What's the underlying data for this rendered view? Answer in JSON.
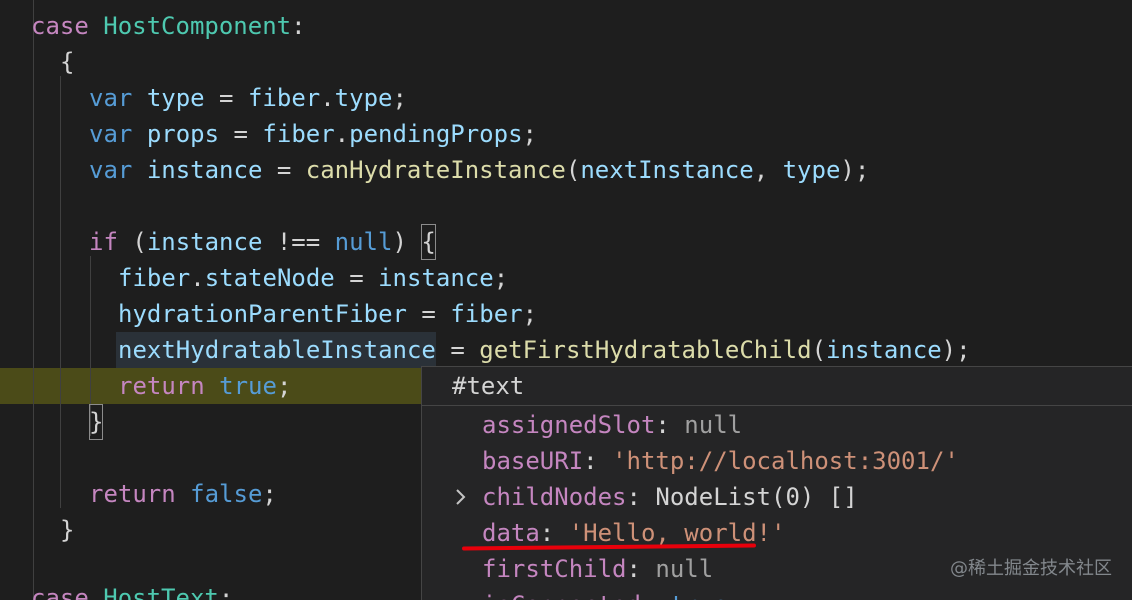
{
  "code": {
    "line_top_fragment": "",
    "case1_kw": "case",
    "case1_name": "HostComponent",
    "case1_colon": ":",
    "open_brace": "{",
    "l_var1_kw": "var",
    "l_var1_name": "type",
    "l_var1_eq": " = ",
    "l_var1_obj": "fiber",
    "l_var1_dot": ".",
    "l_var1_prop": "type",
    "l_var1_end": ";",
    "l_var2_kw": "var",
    "l_var2_name": "props",
    "l_var2_eq": " = ",
    "l_var2_obj": "fiber",
    "l_var2_dot": ".",
    "l_var2_prop": "pendingProps",
    "l_var2_end": ";",
    "l_var3_kw": "var",
    "l_var3_name": "instance",
    "l_var3_eq": " = ",
    "l_var3_fn": "canHydrateInstance",
    "l_var3_open": "(",
    "l_var3_arg1": "nextInstance",
    "l_var3_comma": ", ",
    "l_var3_arg2": "type",
    "l_var3_end": ");",
    "if_kw": "if",
    "if_open": " (",
    "if_var": "instance",
    "if_op": " !== ",
    "if_null": "null",
    "if_close": ") ",
    "if_brace": "{",
    "s1_obj": "fiber",
    "s1_dot": ".",
    "s1_prop": "stateNode",
    "s1_eq": " = ",
    "s1_val": "instance",
    "s1_end": ";",
    "s2_var": "hydrationParentFiber",
    "s2_eq": " = ",
    "s2_val": "fiber",
    "s2_end": ";",
    "s3_var": "nextHydratableInstance",
    "s3_eq": " = ",
    "s3_fn": "getFirstHydratableChild",
    "s3_open": "(",
    "s3_arg": "instance",
    "s3_end": ");",
    "ret_true_kw": "return",
    "ret_true_val": "true",
    "ret_true_end": ";",
    "inner_close": "}",
    "ret_false_kw": "return",
    "ret_false_val": "false",
    "ret_false_end": ";",
    "outer_close": "}",
    "case2_kw": "case",
    "case2_name": "HostText",
    "case2_colon": ":"
  },
  "hover": {
    "title": "#text",
    "props": [
      {
        "name": "assignedSlot",
        "sep": ": ",
        "value": "null"
      },
      {
        "name": "baseURI",
        "sep": ": ",
        "value": "'http://localhost:3001/'"
      },
      {
        "name": "childNodes",
        "sep": ": ",
        "value": "NodeList(0) []"
      },
      {
        "name": "data",
        "sep": ": ",
        "value": "'Hello, world!'"
      },
      {
        "name": "firstChild",
        "sep": ": ",
        "value": "null"
      },
      {
        "name": "isConnected",
        "sep": ": ",
        "value": "true"
      }
    ]
  },
  "watermark": "@稀土掘金技术社区",
  "colors": {
    "background": "#1e1e1e",
    "keyword": "#c586c0",
    "storage": "#569cd6",
    "variable": "#9cdcfe",
    "function": "#dcdcaa",
    "type": "#4ec9b0",
    "string": "#ce9178",
    "current_line": "#4b4b18",
    "annotation": "#e8000b"
  }
}
